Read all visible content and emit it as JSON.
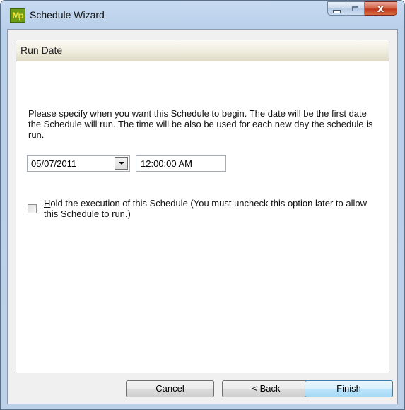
{
  "window": {
    "app_icon_text": "Mp",
    "title": "Schedule Wizard",
    "close_glyph": "x"
  },
  "panel": {
    "header": "Run Date",
    "description": "Please specify when you want this Schedule to begin. The date will be the first date the Schedule will run. The time will be also be used for each new day the schedule is run.",
    "date_value": "05/07/2011",
    "time_value": "12:00:00 AM",
    "hold_checked": false,
    "hold_label_first_letter": "H",
    "hold_label_rest": "old the execution of this Schedule (You must uncheck this option later to allow this Schedule to run.)"
  },
  "buttons": {
    "cancel": "Cancel",
    "back": "< Back",
    "finish": "Finish"
  },
  "icons": [
    "app-icon",
    "minimize-icon",
    "maximize-icon",
    "close-icon",
    "dropdown-arrow-icon"
  ],
  "colors": {
    "title_bar": "#c7daf0",
    "header_band": "#eeebdc",
    "close_button": "#c0391c",
    "default_button_border": "#3c7fb1"
  }
}
